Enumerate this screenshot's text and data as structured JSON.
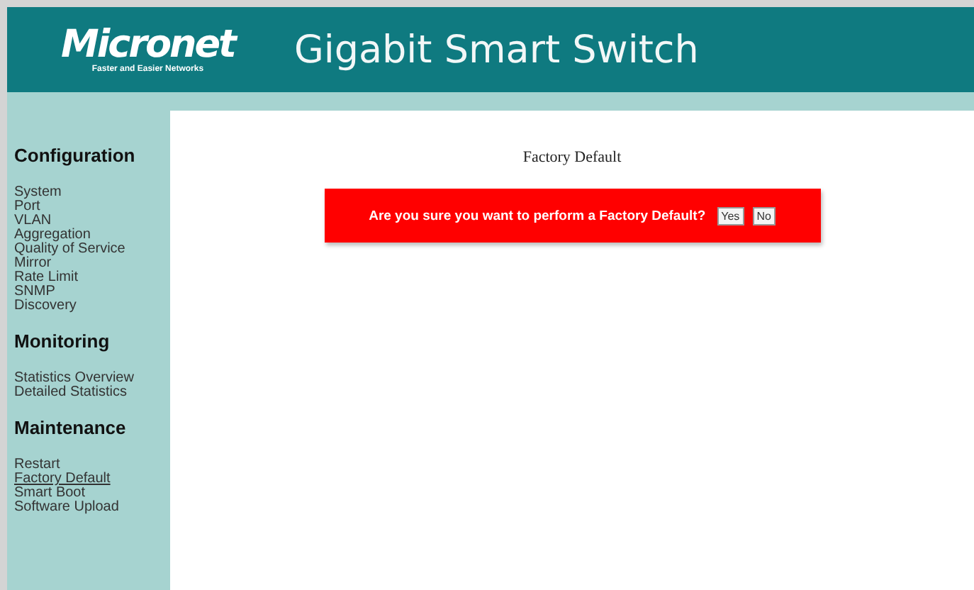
{
  "header": {
    "logo": "Micronet",
    "logo_tagline": "Faster and Easier Networks",
    "title": "Gigabit Smart Switch"
  },
  "sidebar": {
    "sections": [
      {
        "title": "Configuration",
        "items": [
          {
            "label": "System",
            "selected": false
          },
          {
            "label": "Port",
            "selected": false
          },
          {
            "label": "VLAN",
            "selected": false
          },
          {
            "label": "Aggregation",
            "selected": false
          },
          {
            "label": "Quality of Service",
            "selected": false
          },
          {
            "label": "Mirror",
            "selected": false
          },
          {
            "label": "Rate Limit",
            "selected": false
          },
          {
            "label": "SNMP",
            "selected": false
          },
          {
            "label": "Discovery",
            "selected": false
          }
        ]
      },
      {
        "title": "Monitoring",
        "items": [
          {
            "label": "Statistics Overview",
            "selected": false
          },
          {
            "label": "Detailed Statistics",
            "selected": false
          }
        ]
      },
      {
        "title": "Maintenance",
        "items": [
          {
            "label": "Restart",
            "selected": false
          },
          {
            "label": "Factory Default",
            "selected": true
          },
          {
            "label": "Smart Boot",
            "selected": false
          },
          {
            "label": "Software Upload",
            "selected": false
          }
        ]
      }
    ]
  },
  "content": {
    "title": "Factory Default",
    "dialog": {
      "message": "Are you sure you want to perform a Factory Default?",
      "buttons": [
        "Yes",
        "No"
      ]
    }
  }
}
